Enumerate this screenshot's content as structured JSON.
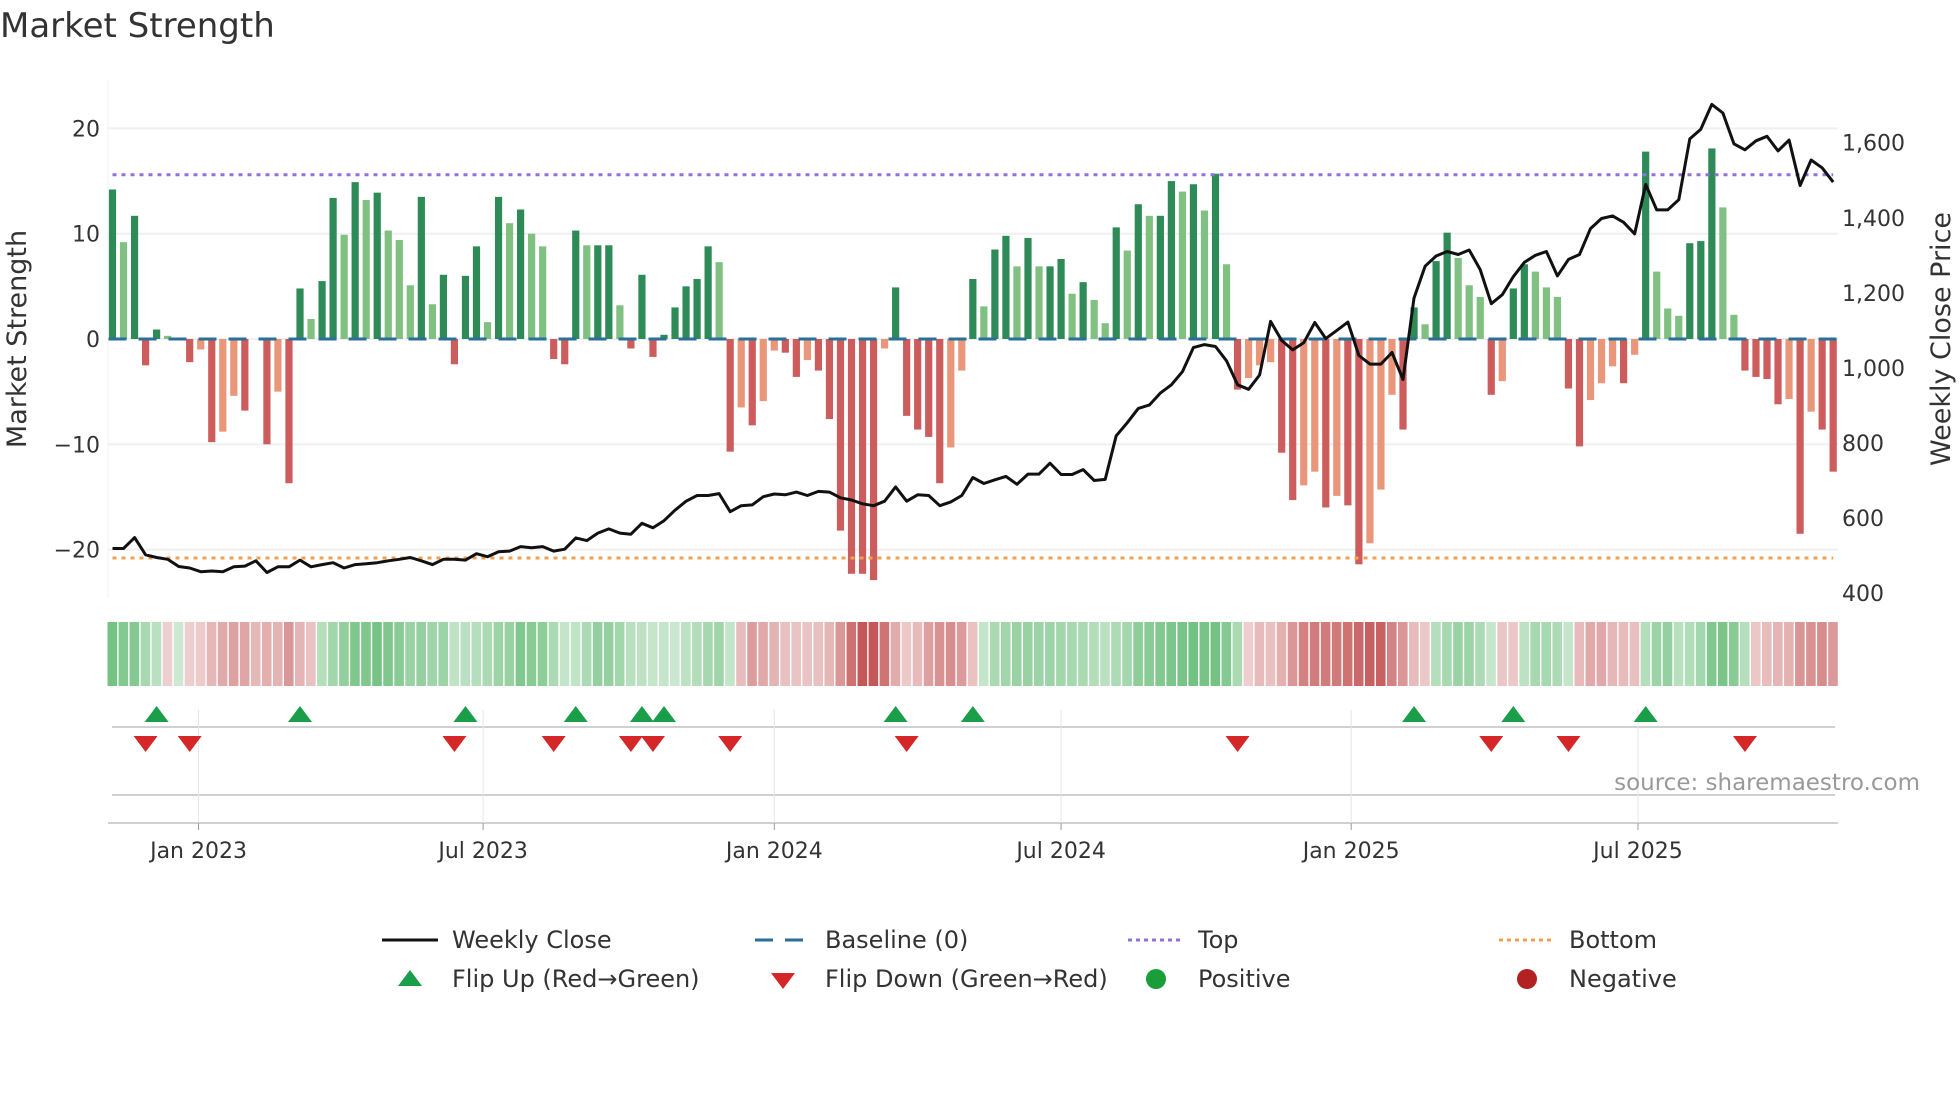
{
  "title": "Market Strength",
  "source": "source: sharemaestro.com",
  "legend": {
    "weekly_close": "Weekly Close",
    "baseline": "Baseline (0)",
    "top": "Top",
    "bottom": "Bottom",
    "flip_up": "Flip Up (Red→Green)",
    "flip_down": "Flip Down (Green→Red)",
    "positive": "Positive",
    "negative": "Negative"
  },
  "colors": {
    "strong_up": "#2e8b57",
    "weak_up": "#80c080",
    "strong_down": "#cd5c5c",
    "weak_down": "#e9967a",
    "price": "#111111",
    "baseline": "#2a6f97",
    "top": "#9370db",
    "bottom": "#f0a050",
    "flip_up": "#1a9e4a",
    "flip_down": "#d62728",
    "positive": "#1a9e3a",
    "negative": "#b22222"
  },
  "chart_data": {
    "type": "bar",
    "title": "Market Strength",
    "ylabel": "Market Strength",
    "y2label": "Weekly Close Price",
    "frequency": "weekly",
    "start_date": "2022-11-07",
    "ylim": [
      -24.6,
      24.6
    ],
    "y2lim": [
      387,
      1767
    ],
    "yticks": [
      "20",
      "10",
      "0",
      "−10",
      "−20"
    ],
    "yticks_values": [
      20,
      10,
      0,
      -10,
      -20
    ],
    "y2ticks": [
      "1,600",
      "1,400",
      "1,200",
      "1,000",
      "800",
      "600",
      "400"
    ],
    "y2ticks_values": [
      1600,
      1400,
      1200,
      1000,
      800,
      600,
      400
    ],
    "xticks": [
      "Jan 2023",
      "Jul 2023",
      "Jan 2024",
      "Jul 2024",
      "Jan 2025",
      "Jul 2025"
    ],
    "xticks_week_index": [
      7.8,
      33.6,
      60,
      86,
      112.3,
      138.3
    ],
    "top_level": 15.6,
    "bottom_level": -20.8,
    "strength": [
      14.2,
      9.2,
      11.7,
      -2.5,
      0.9,
      0.3,
      0,
      -2.2,
      -1.0,
      -9.8,
      -8.8,
      -5.4,
      -6.8,
      0,
      -10,
      -5,
      -13.7,
      4.8,
      1.9,
      5.5,
      13.4,
      9.9,
      14.9,
      13.2,
      13.9,
      10.3,
      9.4,
      5.1,
      13.5,
      3.3,
      6.1,
      -2.4,
      6.0,
      8.8,
      1.6,
      13.5,
      11.0,
      12.3,
      10.0,
      8.8,
      -1.9,
      -2.4,
      10.3,
      8.9,
      8.9,
      8.9,
      3.2,
      -0.9,
      6.1,
      -1.7,
      0.4,
      3.0,
      5.0,
      5.7,
      8.8,
      7.3,
      -10.7,
      -6.5,
      -8.2,
      -5.9,
      -1.1,
      -1.3,
      -3.6,
      -2.0,
      -3.0,
      -7.6,
      -18.2,
      -22.3,
      -22.3,
      -22.9,
      -0.9,
      4.9,
      -7.3,
      -8.6,
      -9.3,
      -13.7,
      -10.3,
      -3.0,
      5.7,
      3.1,
      8.5,
      9.8,
      6.9,
      9.6,
      6.9,
      6.9,
      7.6,
      4.3,
      5.4,
      3.7,
      1.5,
      10.6,
      8.4,
      12.8,
      11.7,
      11.7,
      15.0,
      14.0,
      14.7,
      12.2,
      15.7,
      7.1,
      -4.8,
      -3.7,
      -2.5,
      -2.2,
      -10.8,
      -15.3,
      -13.9,
      -12.6,
      -16.0,
      -14.9,
      -15.8,
      -21.4,
      -19.4,
      -14.3,
      -5.3,
      -8.6,
      3.0,
      1.4,
      7.4,
      10.1,
      7.7,
      5.1,
      4.0,
      -5.3,
      -4.0,
      4.8,
      7.1,
      6.4,
      4.9,
      4.0,
      -4.7,
      -10.2,
      -5.8,
      -4.2,
      -2.6,
      -4.2,
      -1.5,
      17.8,
      6.4,
      2.9,
      2.2,
      9.1,
      9.3,
      18.1,
      12.5,
      2.3,
      -3.0,
      -3.6,
      -3.8,
      -6.2,
      -5.7,
      -18.5,
      -6.9,
      -8.6,
      -12.6
    ],
    "weekly_close": [
      519,
      519,
      548,
      502,
      495,
      490,
      471,
      467,
      457,
      459,
      457,
      470,
      472,
      486,
      455,
      470,
      470,
      488,
      470,
      476,
      481,
      467,
      476,
      478,
      481,
      486,
      490,
      495,
      486,
      476,
      490,
      490,
      488,
      505,
      497,
      510,
      512,
      524,
      521,
      524,
      512,
      517,
      547,
      540,
      560,
      571,
      560,
      557,
      586,
      574,
      593,
      621,
      645,
      660,
      660,
      665,
      617,
      633,
      635,
      657,
      664,
      662,
      669,
      660,
      671,
      669,
      654,
      648,
      638,
      633,
      645,
      683,
      645,
      662,
      660,
      633,
      643,
      660,
      708,
      692,
      702,
      711,
      690,
      717,
      717,
      746,
      716,
      716,
      729,
      700,
      703,
      819,
      854,
      892,
      901,
      933,
      955,
      990,
      1054,
      1062,
      1057,
      1019,
      955,
      943,
      981,
      1124,
      1073,
      1048,
      1067,
      1121,
      1078,
      1100,
      1122,
      1033,
      1010,
      1010,
      1041,
      969,
      1186,
      1271,
      1298,
      1310,
      1302,
      1314,
      1262,
      1171,
      1195,
      1243,
      1281,
      1300,
      1310,
      1245,
      1289,
      1302,
      1371,
      1398,
      1405,
      1388,
      1357,
      1489,
      1421,
      1421,
      1448,
      1610,
      1636,
      1702,
      1679,
      1597,
      1581,
      1605,
      1617,
      1578,
      1607,
      1486,
      1554,
      1533,
      1495
    ],
    "flip_up_week_index": [
      4,
      17,
      32,
      42,
      48,
      50,
      71,
      78,
      118,
      127,
      139
    ],
    "flip_down_week_index": [
      3,
      7,
      31,
      40,
      47,
      49,
      56,
      72,
      102,
      125,
      132,
      148
    ],
    "legend_position": "bottom"
  }
}
